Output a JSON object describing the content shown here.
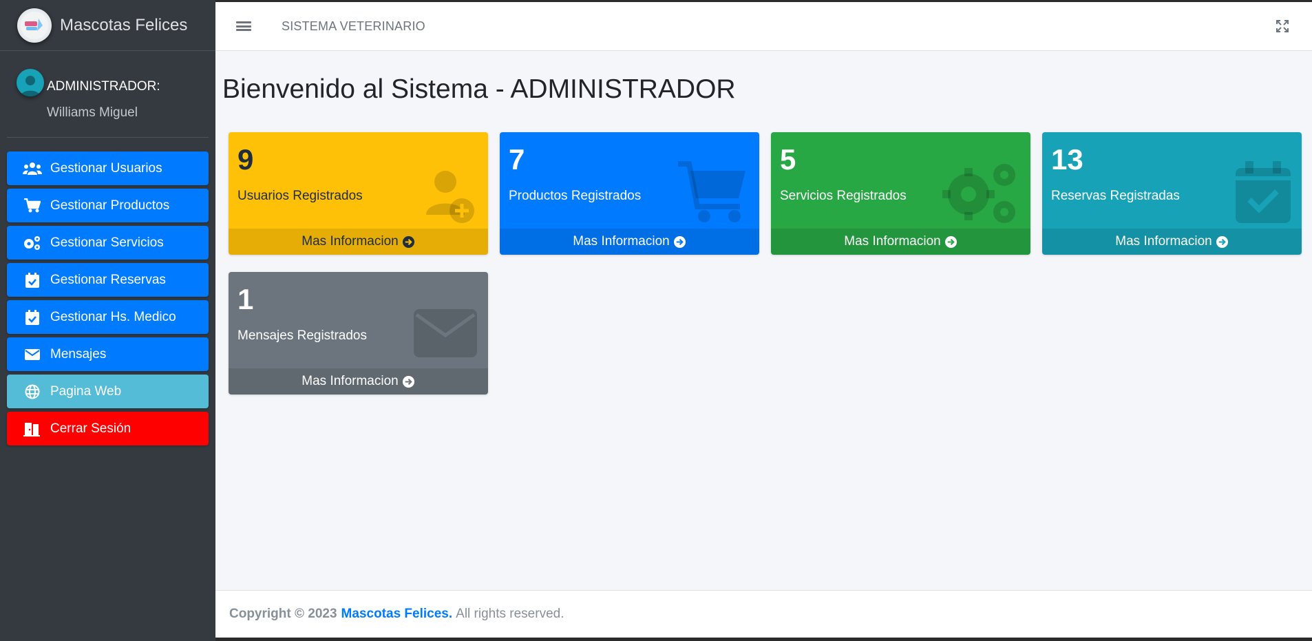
{
  "brand": {
    "name": "Mascotas Felices"
  },
  "user": {
    "role": "ADMINISTRADOR:",
    "name": "Williams Miguel"
  },
  "nav": [
    {
      "label": "Gestionar Usuarios",
      "icon": "users-icon"
    },
    {
      "label": "Gestionar Productos",
      "icon": "cart-icon"
    },
    {
      "label": "Gestionar Servicios",
      "icon": "cogs-icon"
    },
    {
      "label": "Gestionar Reservas",
      "icon": "calendar-check-icon"
    },
    {
      "label": "Gestionar Hs. Medico",
      "icon": "calendar-check-icon"
    },
    {
      "label": "Mensajes",
      "icon": "envelope-icon"
    },
    {
      "label": "Pagina Web",
      "icon": "globe-icon"
    },
    {
      "label": "Cerrar Sesión",
      "icon": "door-exit-icon"
    }
  ],
  "topbar": {
    "title": "SISTEMA VETERINARIO"
  },
  "page": {
    "title": "Bienvenido al Sistema - ADMINISTRADOR"
  },
  "cards": [
    {
      "count": "9",
      "label": "Usuarios Registrados",
      "link": "Mas Informacion",
      "color": "#ffc107",
      "icon": "user-plus-icon"
    },
    {
      "count": "7",
      "label": "Productos Registrados",
      "link": "Mas Informacion",
      "color": "#007bff",
      "icon": "cart-icon"
    },
    {
      "count": "5",
      "label": "Servicios Registrados",
      "link": "Mas Informacion",
      "color": "#28a745",
      "icon": "cogs-icon"
    },
    {
      "count": "13",
      "label": "Reservas Registradas",
      "link": "Mas Informacion",
      "color": "#17a2b8",
      "icon": "calendar-check-icon"
    },
    {
      "count": "1",
      "label": "Mensajes Registrados",
      "link": "Mas Informacion",
      "color": "#6c757d",
      "icon": "envelope-icon"
    }
  ],
  "footer": {
    "copyright": "Copyright © 2023",
    "brand": "Mascotas Felices.",
    "rights": "All rights reserved."
  }
}
